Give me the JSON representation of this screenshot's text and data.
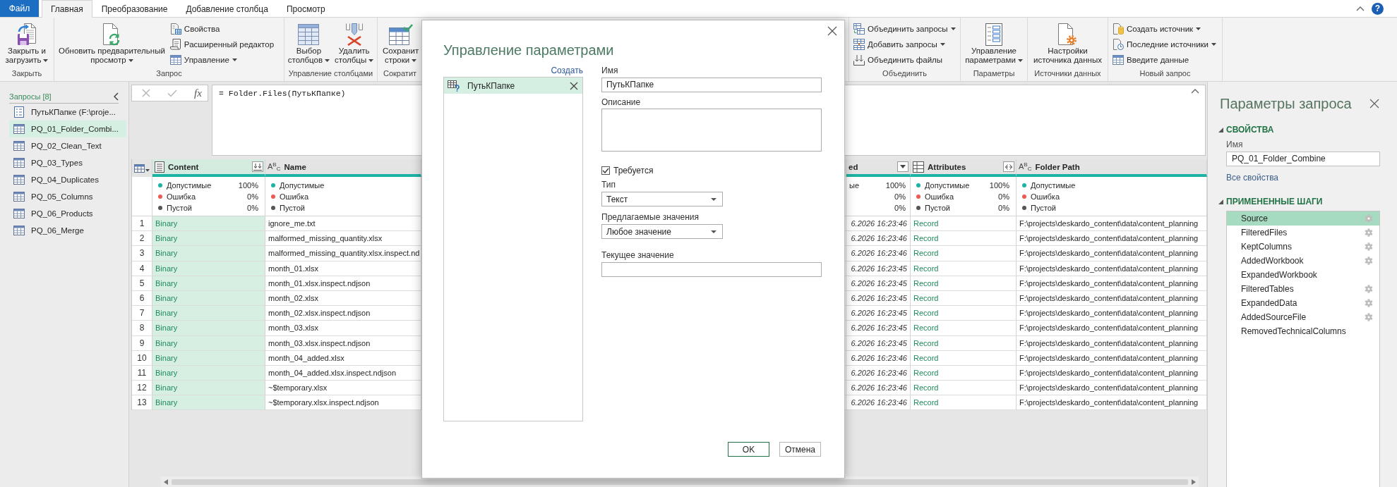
{
  "file_tab": "Файл",
  "tabs": [
    {
      "label": "Главная",
      "selected": true
    },
    {
      "label": "Преобразование",
      "selected": false
    },
    {
      "label": "Добавление столбца",
      "selected": false
    },
    {
      "label": "Просмотр",
      "selected": false
    }
  ],
  "help_button": "?",
  "ribbon": {
    "groups": [
      {
        "label": "Закрыть",
        "buttons": [
          {
            "kind": "large",
            "lines": [
              "Закрыть и",
              "загрузить"
            ],
            "dropdown": true
          }
        ]
      },
      {
        "label": "Запрос",
        "buttons": [
          {
            "kind": "large",
            "lines": [
              "Обновить предварительный",
              "просмотр"
            ],
            "dropdown": true
          },
          {
            "kind": "small",
            "label": "Свойства",
            "dropdown": false
          },
          {
            "kind": "small",
            "label": "Расширенный редактор",
            "dropdown": false
          },
          {
            "kind": "small",
            "label": "Управление",
            "dropdown": true
          }
        ]
      },
      {
        "label": "Управление столбцами",
        "buttons": [
          {
            "kind": "large",
            "lines": [
              "Выбор",
              "столбцов"
            ],
            "dropdown": true
          },
          {
            "kind": "large",
            "lines": [
              "Удалить",
              "столбцы"
            ],
            "dropdown": true
          }
        ]
      },
      {
        "label": "Сократит",
        "buttons": [
          {
            "kind": "large",
            "lines": [
              "Сохранит",
              "строки"
            ],
            "dropdown": true
          }
        ]
      },
      {
        "label": "Объединить",
        "buttons": [
          {
            "kind": "small",
            "label": "Объединить запросы",
            "dropdown": true
          },
          {
            "kind": "small",
            "label": "Добавить запросы",
            "dropdown": true
          },
          {
            "kind": "small",
            "label": "Объединить файлы",
            "dropdown": false
          }
        ]
      },
      {
        "label": "Параметры",
        "buttons": [
          {
            "kind": "large",
            "lines": [
              "Управление",
              "параметрами"
            ],
            "dropdown": true
          }
        ]
      },
      {
        "label": "Источники данных",
        "buttons": [
          {
            "kind": "large",
            "lines": [
              "Настройки",
              "источника данных"
            ],
            "dropdown": false
          }
        ]
      },
      {
        "label": "Новый запрос",
        "buttons": [
          {
            "kind": "small",
            "label": "Создать источник",
            "dropdown": true
          },
          {
            "kind": "small",
            "label": "Последние источники",
            "dropdown": true
          },
          {
            "kind": "small",
            "label": "Введите данные",
            "dropdown": false
          }
        ]
      }
    ]
  },
  "queries_pane": {
    "title": "Запросы [8]",
    "items": [
      {
        "label": "ПутьКПапке (F:\\proje...",
        "kind": "parameter",
        "selected": false
      },
      {
        "label": "PQ_01_Folder_Combi...",
        "kind": "table",
        "selected": true
      },
      {
        "label": "PQ_02_Clean_Text",
        "kind": "table",
        "selected": false
      },
      {
        "label": "PQ_03_Types",
        "kind": "table",
        "selected": false
      },
      {
        "label": "PQ_04_Duplicates",
        "kind": "table",
        "selected": false
      },
      {
        "label": "PQ_05_Columns",
        "kind": "table",
        "selected": false
      },
      {
        "label": "PQ_06_Products",
        "kind": "table",
        "selected": false
      },
      {
        "label": "PQ_06_Merge",
        "kind": "table",
        "selected": false
      }
    ]
  },
  "formula_bar": {
    "fx_label": "fx",
    "formula": "= Folder.Files(ПутьКПапке)"
  },
  "table": {
    "columns": [
      {
        "title": "Content",
        "kind": "binary",
        "selected": true,
        "stats": [
          {
            "label": "Допустимые",
            "value": "100%",
            "color": "#1db3a4"
          },
          {
            "label": "Ошибка",
            "value": "0%",
            "color": "#ec5a52"
          },
          {
            "label": "Пустой",
            "value": "0%",
            "color": "#555555"
          }
        ]
      },
      {
        "title": "Name",
        "kind": "text",
        "type_glyph": "A$^{B}$$_{C}$",
        "selected": false,
        "stats": [
          {
            "label": "Допустимые",
            "color": "#1db3a4"
          },
          {
            "label": "Ошибка",
            "color": "#ec5a52"
          },
          {
            "label": "Пустой",
            "color": "#555555"
          }
        ]
      },
      {
        "title": "ed",
        "kind": "datetime",
        "selected": false,
        "stats": [
          {
            "label": "ые",
            "value": "100%"
          },
          {
            "value": "0%"
          },
          {
            "value": "0%"
          }
        ]
      },
      {
        "title": "Attributes",
        "kind": "record",
        "selected": false,
        "stats": [
          {
            "label": "Допустимые",
            "value": "100%",
            "color": "#1db3a4"
          },
          {
            "label": "Ошибка",
            "value": "0%",
            "color": "#ec5a52"
          },
          {
            "label": "Пустой",
            "value": "0%",
            "color": "#555555"
          }
        ]
      },
      {
        "title": "Folder Path",
        "kind": "text",
        "type_glyph": "A$^{B}$$_{C}$",
        "selected": false,
        "stats": [
          {
            "label": "Допустимые",
            "color": "#1db3a4"
          },
          {
            "label": "Ошибка",
            "color": "#ec5a52"
          },
          {
            "label": "Пустой",
            "color": "#555555"
          }
        ]
      }
    ],
    "rows": [
      {
        "number": "1",
        "cells": [
          "Binary",
          "ignore_me.txt",
          "6.2026 16:23:46",
          "Record",
          "F:\\projects\\deskardo_content\\data\\content_planning"
        ]
      },
      {
        "number": "2",
        "cells": [
          "Binary",
          "malformed_missing_quantity.xlsx",
          "6.2026 16:23:46",
          "Record",
          "F:\\projects\\deskardo_content\\data\\content_planning"
        ]
      },
      {
        "number": "3",
        "cells": [
          "Binary",
          "malformed_missing_quantity.xlsx.inspect.nd",
          "6.2026 16:23:46",
          "Record",
          "F:\\projects\\deskardo_content\\data\\content_planning"
        ]
      },
      {
        "number": "4",
        "cells": [
          "Binary",
          "month_01.xlsx",
          "6.2026 16:23:45",
          "Record",
          "F:\\projects\\deskardo_content\\data\\content_planning"
        ]
      },
      {
        "number": "5",
        "cells": [
          "Binary",
          "month_01.xlsx.inspect.ndjson",
          "6.2026 16:23:45",
          "Record",
          "F:\\projects\\deskardo_content\\data\\content_planning"
        ]
      },
      {
        "number": "6",
        "cells": [
          "Binary",
          "month_02.xlsx",
          "6.2026 16:23:45",
          "Record",
          "F:\\projects\\deskardo_content\\data\\content_planning"
        ]
      },
      {
        "number": "7",
        "cells": [
          "Binary",
          "month_02.xlsx.inspect.ndjson",
          "6.2026 16:23:45",
          "Record",
          "F:\\projects\\deskardo_content\\data\\content_planning"
        ]
      },
      {
        "number": "8",
        "cells": [
          "Binary",
          "month_03.xlsx",
          "6.2026 16:23:45",
          "Record",
          "F:\\projects\\deskardo_content\\data\\content_planning"
        ]
      },
      {
        "number": "9",
        "cells": [
          "Binary",
          "month_03.xlsx.inspect.ndjson",
          "6.2026 16:23:45",
          "Record",
          "F:\\projects\\deskardo_content\\data\\content_planning"
        ]
      },
      {
        "number": "10",
        "cells": [
          "Binary",
          "month_04_added.xlsx",
          "6.2026 16:23:46",
          "Record",
          "F:\\projects\\deskardo_content\\data\\content_planning"
        ]
      },
      {
        "number": "11",
        "cells": [
          "Binary",
          "month_04_added.xlsx.inspect.ndjson",
          "6.2026 16:23:46",
          "Record",
          "F:\\projects\\deskardo_content\\data\\content_planning"
        ]
      },
      {
        "number": "12",
        "cells": [
          "Binary",
          "~$temporary.xlsx",
          "6.2026 16:23:46",
          "Record",
          "F:\\projects\\deskardo_content\\data\\content_planning"
        ]
      },
      {
        "number": "13",
        "cells": [
          "Binary",
          "~$temporary.xlsx.inspect.ndjson",
          "6.2026 16:23:46",
          "Record",
          "F:\\projects\\deskardo_content\\data\\content_planning"
        ]
      }
    ]
  },
  "query_settings": {
    "title": "Параметры запроса",
    "properties": {
      "heading": "СВОЙСТВА",
      "expanded": true,
      "name_label": "Имя",
      "name_value": "PQ_01_Folder_Combine",
      "all_properties_link": "Все свойства"
    },
    "steps": {
      "heading": "ПРИМЕНЕННЫЕ ШАГИ",
      "expanded": true,
      "items": [
        {
          "label": "Source",
          "selected": true,
          "has_settings": true
        },
        {
          "label": "FilteredFiles",
          "selected": false,
          "has_settings": true
        },
        {
          "label": "KeptColumns",
          "selected": false,
          "has_settings": true
        },
        {
          "label": "AddedWorkbook",
          "selected": false,
          "has_settings": true
        },
        {
          "label": "ExpandedWorkbook",
          "selected": false,
          "has_settings": false
        },
        {
          "label": "FilteredTables",
          "selected": false,
          "has_settings": true
        },
        {
          "label": "ExpandedData",
          "selected": false,
          "has_settings": true
        },
        {
          "label": "AddedSourceFile",
          "selected": false,
          "has_settings": true
        },
        {
          "label": "RemovedTechnicalColumns",
          "selected": false,
          "has_settings": false
        }
      ]
    }
  },
  "dialog": {
    "title": "Управление параметрами",
    "create_link": "Создать",
    "parameters": [
      {
        "name": "ПутьКПапке",
        "selected": true
      }
    ],
    "name_label": "Имя",
    "name_value": "ПутьКПапке",
    "description_label": "Описание",
    "required": {
      "label": "Требуется",
      "checked": true
    },
    "type_label": "Тип",
    "type_value": "Текст",
    "suggested_label": "Предлагаемые значения",
    "suggested_value": "Любое значение",
    "current_label": "Текущее значение",
    "buttons": [
      {
        "label": "OK",
        "primary": true
      },
      {
        "label": "Отмена",
        "primary": false
      }
    ]
  }
}
